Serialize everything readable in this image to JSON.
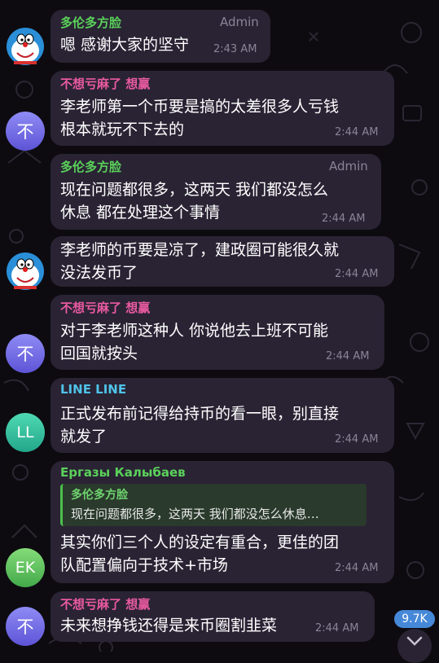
{
  "colors": {
    "background": "#0d0b10",
    "bubble": "#2a2334",
    "sender_green": "#5ad15a",
    "sender_pink": "#e85aa0",
    "sender_cyan": "#4fc3e8",
    "badge": "#4688d8"
  },
  "messages": [
    {
      "sender": "多伦多方脸",
      "role": "Admin",
      "text": [
        "嗯 感谢大家的坚守"
      ],
      "time": "2:43 AM",
      "avatar_icon": "doraemon-avatar-icon"
    },
    {
      "sender": "不想亏麻了 想赢",
      "text": [
        "李老师第一个币要是搞的太差很多人亏钱",
        "根本就玩不下去的"
      ],
      "time": "2:44 AM",
      "avatar": "不"
    },
    {
      "sender": "多伦多方脸",
      "role": "Admin",
      "text": [
        "现在问题都很多，这两天 我们都没怎么",
        "休息 都在处理这个事情"
      ],
      "time": "2:44 AM"
    },
    {
      "text": [
        "李老师的币要是凉了，建政圈可能很久就",
        "没法发币了"
      ],
      "time": "2:44 AM",
      "avatar_icon": "doraemon-avatar-icon"
    },
    {
      "sender": "不想亏麻了 想赢",
      "text": [
        "对于李老师这种人 你说他去上班不可能",
        "回国就按头"
      ],
      "time": "2:44 AM",
      "avatar": "不"
    },
    {
      "sender": "LINE LINE",
      "text": [
        "正式发布前记得给持币的看一眼，别直接",
        "就发了"
      ],
      "time": "2:44 AM",
      "avatar": "LL"
    },
    {
      "sender": "Ергазы Калыбаев",
      "quote": {
        "name": "多伦多方脸",
        "text": "现在问题都很多，这两天 我们都没怎么休息…"
      },
      "text": [
        "其实你们三个人的设定有重合，更佳的团",
        "队配置偏向于技术+市场"
      ],
      "time": "2:44 AM",
      "avatar": "EK"
    },
    {
      "sender": "不想亏麻了 想赢",
      "text": [
        "未来想挣钱还得是来币圈割韭菜"
      ],
      "time": "2:44 AM",
      "avatar": "不"
    }
  ],
  "view_count": "9.7K",
  "scroll_icon": "chevron-down-icon"
}
